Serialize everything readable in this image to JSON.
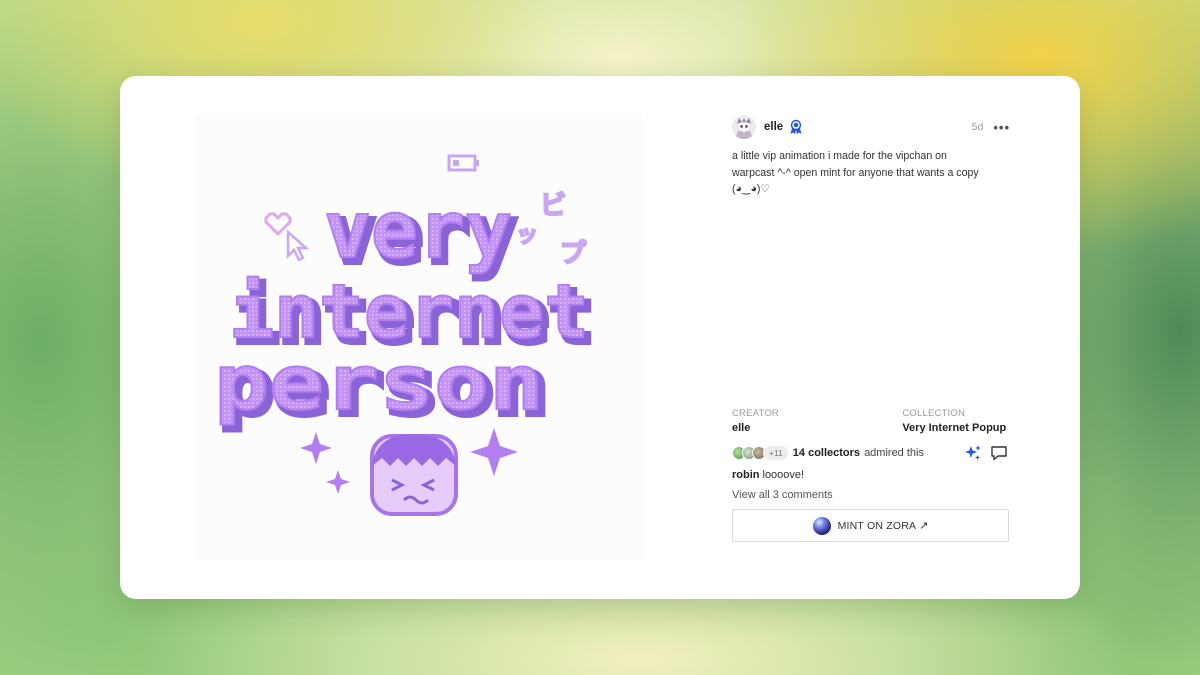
{
  "post": {
    "author": "elle",
    "time": "5d",
    "caption": "a little vip animation i made for the vipchan on\nwarpcast ^-^ open mint for anyone that wants a copy\n(◕‿◕)♡",
    "artwork_text": [
      "very",
      "internet",
      "person"
    ],
    "badge_icon": "verified-badge-icon",
    "more_icon": "more-options-icon"
  },
  "meta": {
    "creator_label": "CREATOR",
    "creator_value": "elle",
    "collection_label": "COLLECTION",
    "collection_value": "Very Internet Popup"
  },
  "collectors": {
    "extra_count": "+11",
    "count_text": "14 collectors",
    "admired_text": "admired this",
    "icons": [
      "sparkle-icon",
      "comment-icon"
    ]
  },
  "comment": {
    "user": "robin",
    "text": "loooove!"
  },
  "view_comments": "View all 3 comments",
  "mint": {
    "label": "MINT ON ZORA",
    "arrow": "↗"
  },
  "colors": {
    "art_purple": "#b27ef0",
    "art_shadow": "#8a63d6",
    "badge_blue": "#2a5bd7"
  }
}
